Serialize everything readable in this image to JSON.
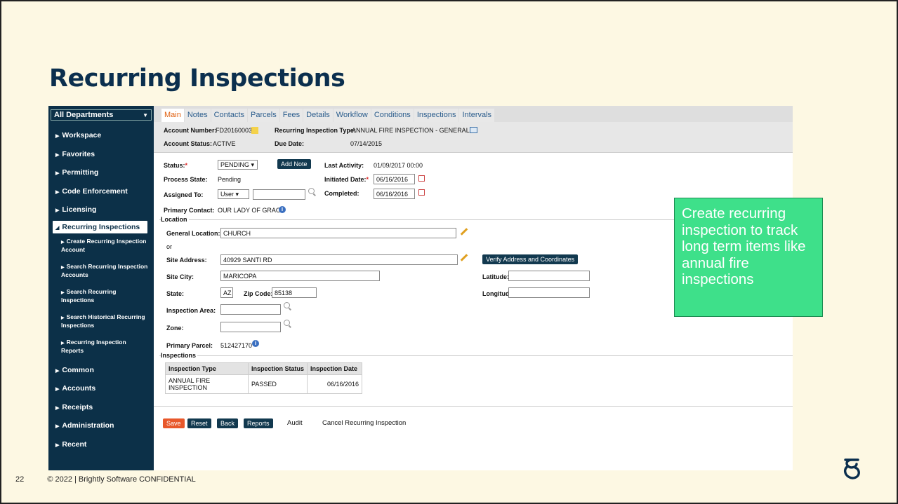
{
  "slide": {
    "title": "Recurring Inspections",
    "page_number": "22",
    "confidential": "© 2022 | Brightly Software CONFIDENTIAL",
    "callout": "Create recurring inspection to track long term items like annual fire inspections"
  },
  "sidebar": {
    "department": "All Departments",
    "items": [
      {
        "label": "Workspace"
      },
      {
        "label": "Favorites"
      },
      {
        "label": "Permitting"
      },
      {
        "label": "Code Enforcement"
      },
      {
        "label": "Licensing"
      },
      {
        "label": "Recurring Inspections"
      }
    ],
    "sub_items": [
      {
        "label": "Create Recurring Inspection Account"
      },
      {
        "label": "Search Recurring Inspection Accounts"
      },
      {
        "label": "Search Recurring Inspections"
      },
      {
        "label": "Search Historical Recurring Inspections"
      },
      {
        "label": "Recurring Inspection Reports"
      }
    ],
    "items_after": [
      {
        "label": "Common"
      },
      {
        "label": "Accounts"
      },
      {
        "label": "Receipts"
      },
      {
        "label": "Administration"
      },
      {
        "label": "Recent"
      }
    ]
  },
  "tabs": [
    "Main",
    "Notes",
    "Contacts",
    "Parcels",
    "Fees",
    "Details",
    "Workflow",
    "Conditions",
    "Inspections",
    "Intervals"
  ],
  "account": {
    "number_label": "Account Number:",
    "number": "FD20160003",
    "type_label": "Recurring Inspection Type:",
    "type": "ANNUAL FIRE INSPECTION - GENERAL",
    "status_label": "Account Status:",
    "status": "ACTIVE",
    "due_label": "Due Date:",
    "due": "07/14/2015"
  },
  "form": {
    "status_label": "Status:",
    "status_value": "PENDING ▾",
    "add_note": "Add Note",
    "last_activity_label": "Last Activity:",
    "last_activity": "01/09/2017 00:00",
    "process_state_label": "Process State:",
    "process_state": "Pending",
    "initiated_label": "Initiated Date:",
    "initiated": "06/16/2016",
    "assigned_label": "Assigned To:",
    "assigned_value": "User ▾",
    "completed_label": "Completed:",
    "completed": "06/16/2016",
    "primary_contact_label": "Primary Contact:",
    "primary_contact": "OUR LADY OF GRACE"
  },
  "location": {
    "title": "Location",
    "general_label": "General Location:",
    "general": "CHURCH",
    "or": "or",
    "site_address_label": "Site Address:",
    "site_address": "40929 SANTI RD",
    "verify": "Verify Address and Coordinates",
    "site_city_label": "Site City:",
    "site_city": "MARICOPA",
    "latitude_label": "Latitude:",
    "state_label": "State:",
    "state": "AZ",
    "zip_label": "Zip Code:",
    "zip": "85138",
    "longitude_label": "Longitude:",
    "inspection_area_label": "Inspection Area:",
    "zone_label": "Zone:",
    "primary_parcel_label": "Primary Parcel:",
    "primary_parcel": "512427170"
  },
  "inspections": {
    "title": "Inspections",
    "headers": [
      "Inspection Type",
      "Inspection Status",
      "Inspection Date"
    ],
    "rows": [
      [
        "ANNUAL FIRE INSPECTION",
        "PASSED",
        "06/16/2016"
      ]
    ]
  },
  "actions": {
    "save": "Save",
    "reset": "Reset",
    "back": "Back",
    "reports": "Reports",
    "audit": "Audit",
    "cancel": "Cancel Recurring Inspection"
  }
}
